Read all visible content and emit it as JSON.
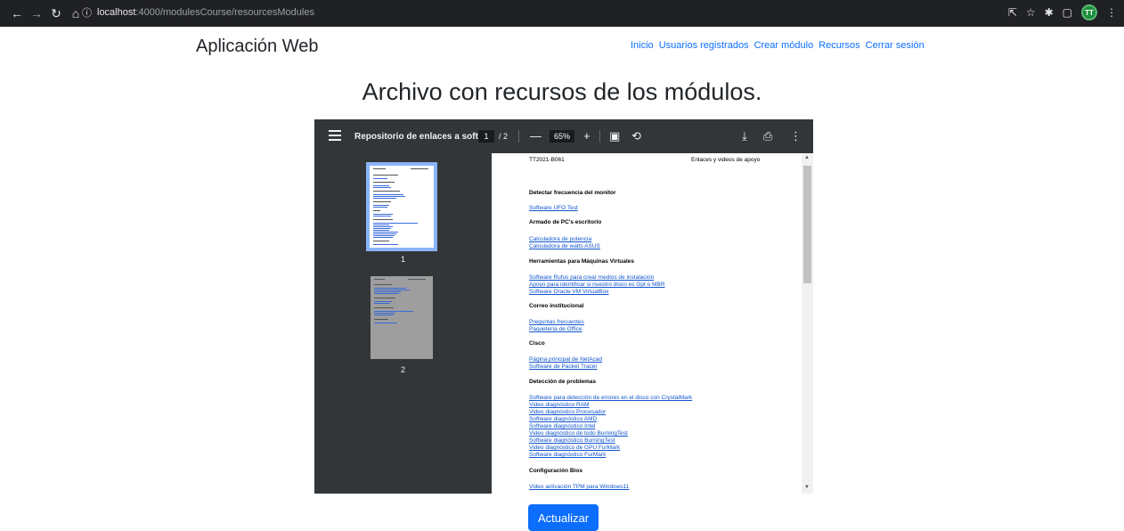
{
  "browser": {
    "url_host": "localhost",
    "url_path": ":4000/modulesCourse/resourcesModules",
    "avatar_initials": "TT",
    "icons": [
      "back-arrow-icon",
      "forward-arrow-icon",
      "reload-icon",
      "home-icon",
      "info-icon",
      "share-icon",
      "star-icon",
      "extension-icon",
      "sidepanel-icon",
      "menu-dots-icon"
    ]
  },
  "navbar": {
    "brand": "Aplicación Web",
    "links": [
      "Inicio",
      "Usuarios registrados",
      "Crear módulo",
      "Recursos",
      "Cerrar sesión"
    ]
  },
  "page": {
    "title": "Archivo con recursos de los módulos."
  },
  "pdf": {
    "title": "Repositorio de enlaces a soft...",
    "current_page": "1",
    "total_pages": "/ 2",
    "zoom": "65%",
    "thumbnails": [
      "1",
      "2"
    ],
    "doc_header_left": "TT2021-B061",
    "doc_header_right": "Enlaces y videos de apoyo",
    "sections": [
      {
        "heading": "Detectar frecuencia del monitor",
        "links": [
          "Software UFO Test"
        ]
      },
      {
        "heading": "Armado de PC's escritorio",
        "links": [
          "Calculadora de potencia",
          "Calculadora de watts ASUS"
        ]
      },
      {
        "heading": "Herramientas para Máquinas Virtuales",
        "links": [
          "Software Rufus para crear medios de instalación",
          "Apoyo para identificar si nuestro disco es Gpt o MBR",
          "Software Oracle VM VirtualBox"
        ]
      },
      {
        "heading": "Correo institucional",
        "links": [
          "Preguntas frecuentes",
          "Paquetería de Office"
        ]
      },
      {
        "heading": "Cisco",
        "links": [
          "Página principal de NetAcad",
          "Software de Packet Tracer"
        ]
      },
      {
        "heading": "Detección de problemas",
        "links": [
          "Software para detección de errores en el disco con CrystalMark",
          "Video diagnóstico RAM",
          "Video diagnóstico Procesador",
          "Software diagnóstico AMD",
          "Software diagnóstico Intel",
          "Video diagnóstico de todo BurningTest",
          "Software diagnóstico BurningTest",
          "Video diagnóstico de GPU FurMark",
          "Software diagnóstico FurMark"
        ]
      },
      {
        "heading": "Configuración Bios",
        "links": [
          "Video activación TPM para Windows11"
        ]
      }
    ]
  },
  "actions": {
    "update_label": "Actualizar"
  },
  "colors": {
    "link": "#0d6efd",
    "button": "#0d6efd",
    "pdf_toolbar": "#323639",
    "pdf_background": "#525659",
    "doc_link": "#1155cc"
  }
}
